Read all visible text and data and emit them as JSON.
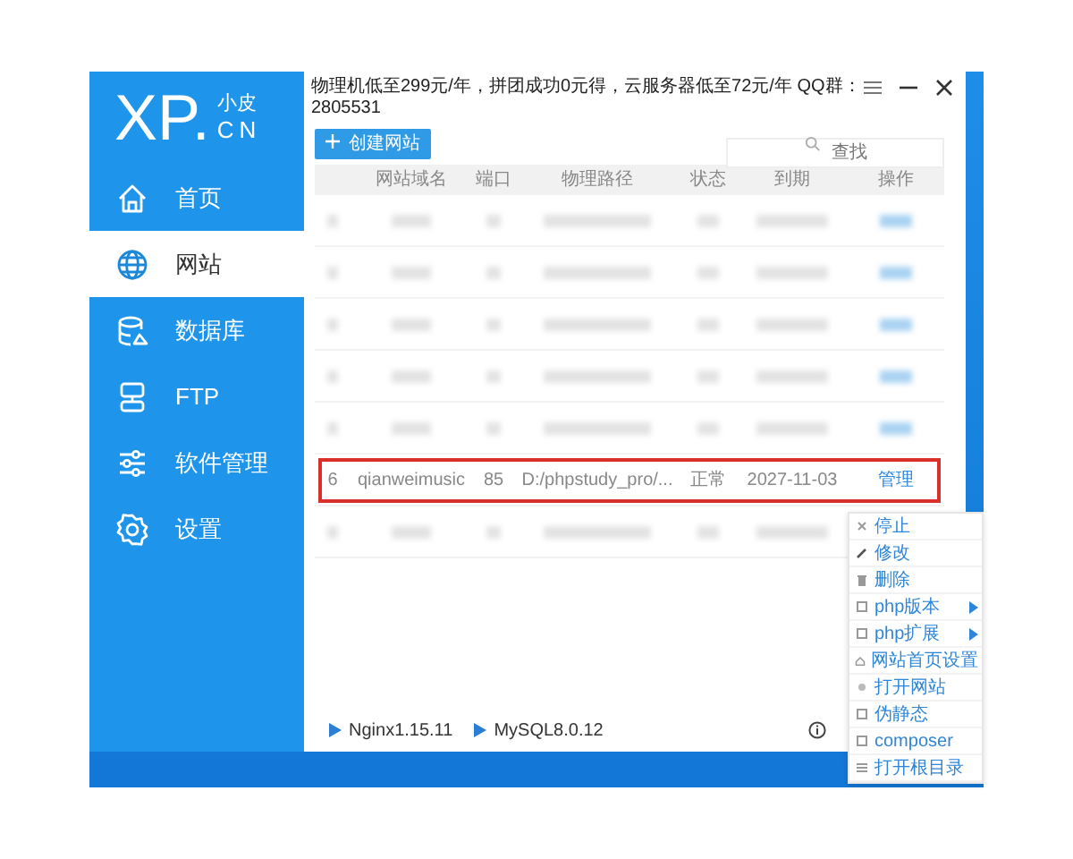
{
  "logo": {
    "main": "XP.",
    "top": "小皮",
    "bottom": "CN"
  },
  "sidebar": {
    "items": [
      {
        "label": "首页",
        "selected": false
      },
      {
        "label": "网站",
        "selected": true
      },
      {
        "label": "数据库",
        "selected": false
      },
      {
        "label": "FTP",
        "selected": false
      },
      {
        "label": "软件管理",
        "selected": false
      },
      {
        "label": "设置",
        "selected": false
      }
    ]
  },
  "top_bar": {
    "notice": "物理机低至299元/年，拼团成功0元得，云服务器低至72元/年 QQ群：2805531"
  },
  "toolbar": {
    "create_button": "创建网站",
    "search": {
      "placeholder": "查找"
    }
  },
  "table": {
    "columns": [
      "",
      "网站域名",
      "端口",
      "物理路径",
      "状态",
      "到期",
      "操作"
    ],
    "rows": [
      {
        "kind": "blurred"
      },
      {
        "kind": "blurred"
      },
      {
        "kind": "blurred"
      },
      {
        "kind": "blurred"
      },
      {
        "kind": "blurred"
      },
      {
        "kind": "site",
        "highlighted": true,
        "cells": [
          "6",
          "qianweimusic",
          "85",
          "D:/phpstudy_pro/...",
          "正常",
          "2027-11-03"
        ],
        "action": "管理"
      },
      {
        "kind": "blurred"
      }
    ]
  },
  "context_menu": {
    "items": [
      {
        "label": "停止",
        "submenu": false
      },
      {
        "label": "修改",
        "submenu": false
      },
      {
        "label": "删除",
        "submenu": false
      },
      {
        "label": "php版本",
        "submenu": true
      },
      {
        "label": "php扩展",
        "submenu": true
      },
      {
        "label": "网站首页设置",
        "submenu": false
      },
      {
        "label": "打开网站",
        "submenu": false
      },
      {
        "label": "伪静态",
        "submenu": false
      },
      {
        "label": "composer",
        "submenu": false
      },
      {
        "label": "打开根目录",
        "submenu": false
      }
    ]
  },
  "status_bar": {
    "services": [
      "Nginx1.15.11",
      "MySQL8.0.12"
    ]
  }
}
